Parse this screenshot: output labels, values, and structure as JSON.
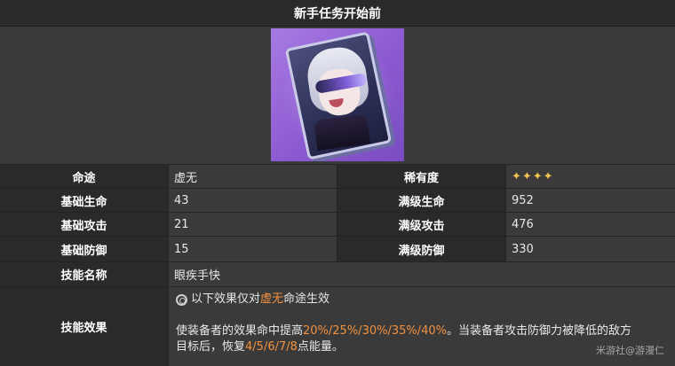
{
  "header": {
    "title": "新手任务开始前"
  },
  "card": {
    "icon": "light-cone-card-image"
  },
  "stats": {
    "path_label": "命途",
    "path_value": "虚无",
    "rarity_label": "稀有度",
    "rarity_value": "✦✦✦✦",
    "rows": [
      {
        "label": "基础生命",
        "value": "43",
        "max_label": "满级生命",
        "max_value": "952"
      },
      {
        "label": "基础攻击",
        "value": "21",
        "max_label": "满级攻击",
        "max_value": "476"
      },
      {
        "label": "基础防御",
        "value": "15",
        "max_label": "满级防御",
        "max_value": "330"
      }
    ]
  },
  "skill": {
    "name_label": "技能名称",
    "name_value": "眼疾手快",
    "effect_label": "技能效果",
    "path_prefix": "以下效果仅对",
    "path_name": "虚无",
    "path_suffix": "命途生效",
    "effect_part1": "使装备者的效果命中提高",
    "effect_values1": "20%/25%/30%/35%/40%",
    "effect_part2": "。当装备者攻击防御力被降低的敌方",
    "effect_part3": "目标后，恢复",
    "effect_values2": "4/5/6/7/8",
    "effect_part4": "点能量。"
  },
  "watermark": "米游社@游漫仁",
  "colors": {
    "highlight": "#f3913f",
    "star": "#f2c14e",
    "label_bg": "#2c2a28",
    "value_bg": "#3a3a3a"
  }
}
